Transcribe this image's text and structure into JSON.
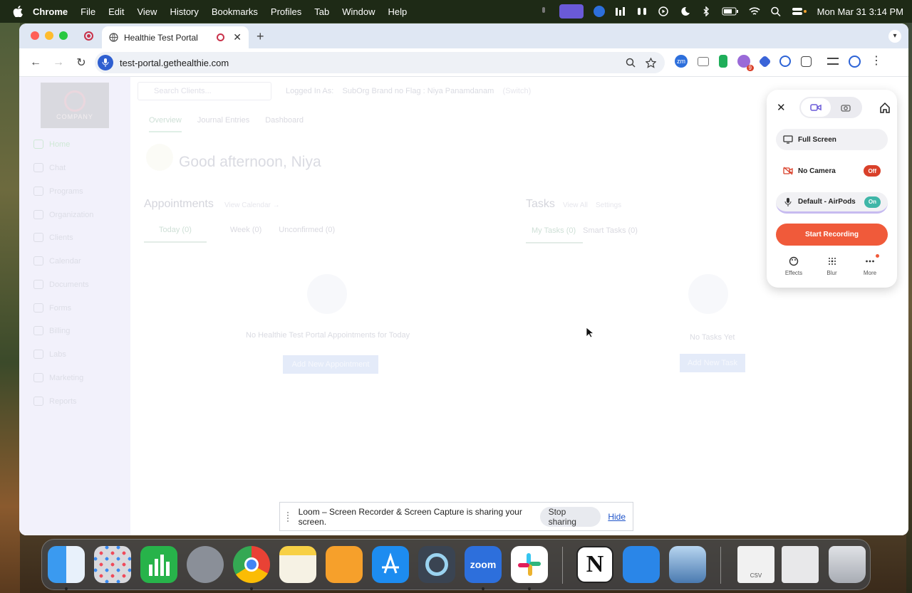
{
  "menubar": {
    "app": "Chrome",
    "items": [
      "File",
      "Edit",
      "View",
      "History",
      "Bookmarks",
      "Profiles",
      "Tab",
      "Window",
      "Help"
    ],
    "clock": "Mon Mar 31  3:14 PM"
  },
  "browser": {
    "tab_title": "Healthie Test Portal",
    "url": "test-portal.gethealthie.com",
    "extension_badge": "9"
  },
  "page": {
    "logo_text": "COMPANY",
    "sidebar": [
      "Home",
      "Chat",
      "Programs",
      "Organization",
      "Clients",
      "Calendar",
      "Documents",
      "Forms",
      "Billing",
      "Labs",
      "Marketing",
      "Reports"
    ],
    "search_placeholder": "Search Clients...",
    "logged_in_label": "Logged In As:",
    "logged_in_value": "SubOrg Brand no Flag : Niya Panamdanam",
    "switch_label": "(Switch)",
    "tabs": [
      "Overview",
      "Journal Entries",
      "Dashboard"
    ],
    "greeting": "Good afternoon, Niya",
    "appointments": {
      "title": "Appointments",
      "link": "View Calendar →",
      "tabs": [
        "Today (0)",
        "Week (0)",
        "Unconfirmed (0)"
      ],
      "empty": "No Healthie Test Portal Appointments for Today",
      "button": "Add New Appointment"
    },
    "tasks": {
      "title": "Tasks",
      "link_all": "View All",
      "link_settings": "Settings",
      "tabs": [
        "My Tasks (0)",
        "Smart Tasks (0)"
      ],
      "empty": "No Tasks Yet",
      "button": "Add New Task"
    }
  },
  "loom": {
    "full_screen": "Full Screen",
    "camera": "No Camera",
    "camera_state": "Off",
    "mic": "Default - AirPods",
    "mic_state": "On",
    "start": "Start Recording",
    "actions": [
      "Effects",
      "Blur",
      "More"
    ],
    "colors": {
      "accent": "#f05a3a",
      "off": "#d9402a",
      "on": "#3fb6a8"
    }
  },
  "sharebar": {
    "message": "Loom – Screen Recorder & Screen Capture is sharing your screen.",
    "stop": "Stop sharing",
    "hide": "Hide"
  },
  "dock": {
    "apps": [
      "finder",
      "launchpad",
      "numbers",
      "system-settings",
      "chrome",
      "notes",
      "pages",
      "app-store",
      "quicktime",
      "zoom",
      "slack",
      "notion",
      "keynote",
      "preview",
      "csv-file",
      "screenshot",
      "trash"
    ],
    "zoom_label": "zoom",
    "csv_label": "CSV"
  }
}
